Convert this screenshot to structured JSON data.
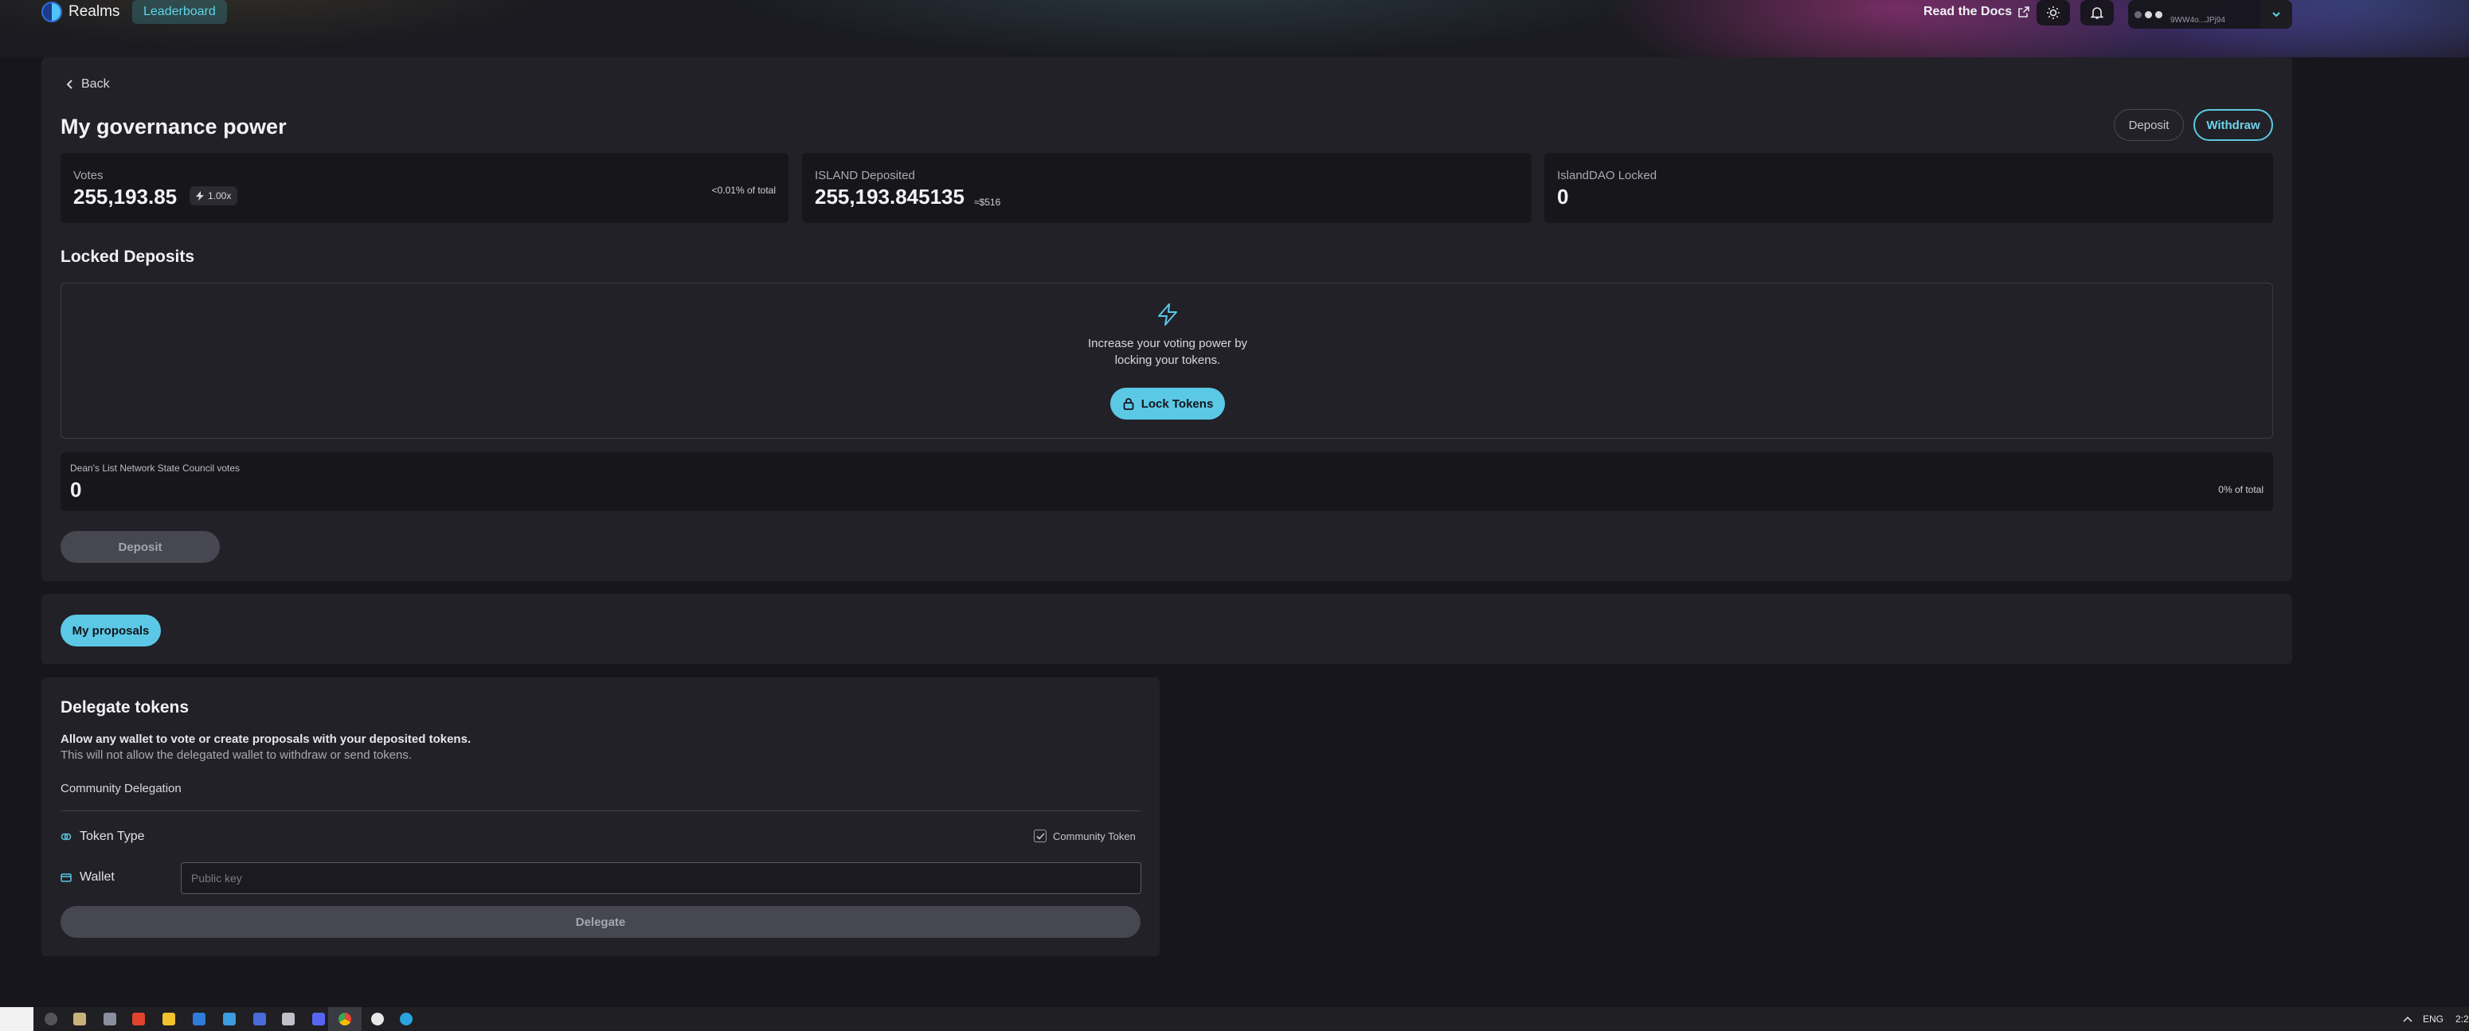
{
  "nav": {
    "brand": "Realms",
    "leaderboard_label": "Leaderboard",
    "docs_label": "Read the Docs",
    "wallet_address": "9WW4o...JPj94"
  },
  "page": {
    "back_label": "Back",
    "title": "My governance power",
    "deposit_label": "Deposit",
    "withdraw_label": "Withdraw"
  },
  "stats": {
    "votes": {
      "label": "Votes",
      "value": "255,193.85",
      "multiplier": "1.00x",
      "share": "<0.01% of total"
    },
    "deposited": {
      "label": "ISLAND Deposited",
      "value": "255,193.845135",
      "usd": "≈$516"
    },
    "locked": {
      "label": "IslandDAO Locked",
      "value": "0"
    }
  },
  "locked_deposits": {
    "title": "Locked Deposits",
    "message_line1": "Increase your voting power by",
    "message_line2": "locking your tokens.",
    "lock_button": "Lock Tokens"
  },
  "council": {
    "label": "Dean's List Network State Council votes",
    "value": "0",
    "share": "0% of total",
    "deposit_label": "Deposit"
  },
  "proposals": {
    "button": "My proposals"
  },
  "delegate": {
    "title": "Delegate tokens",
    "desc1": "Allow any wallet to vote or create proposals with your deposited tokens.",
    "desc2": "This will not allow the delegated wallet to withdraw or send tokens.",
    "subtitle": "Community Delegation",
    "token_type_label": "Token Type",
    "community_token_label": "Community Token",
    "community_token_checked": true,
    "wallet_label": "Wallet",
    "wallet_placeholder": "Public key",
    "button": "Delegate"
  },
  "taskbar": {
    "language": "ENG",
    "clock": "2:2"
  },
  "colors": {
    "accent": "#5bc8e6",
    "background": "#17161c",
    "panel": "#222128",
    "card": "#17161b"
  }
}
